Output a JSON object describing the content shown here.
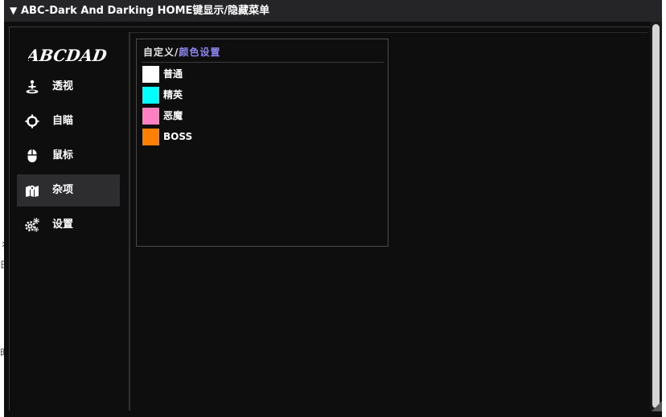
{
  "window": {
    "collapse_arrow": "▼",
    "title": "ABC-Dark And Darking HOME键显示/隐藏菜单"
  },
  "logo": {
    "text": "ABCDAD"
  },
  "sidebar": {
    "items": [
      {
        "label": "透视",
        "icon": "person-icon",
        "active": false
      },
      {
        "label": "自瞄",
        "icon": "crosshair-icon",
        "active": false
      },
      {
        "label": "鼠标",
        "icon": "mouse-icon",
        "active": false
      },
      {
        "label": "杂项",
        "icon": "map-icon",
        "active": true
      },
      {
        "label": "设置",
        "icon": "gears-icon",
        "active": false
      }
    ]
  },
  "panel": {
    "header_part1": "自定义",
    "header_sep": "/",
    "header_part2": "颜色设置",
    "header_part2_color": "#8c86f0",
    "colors": [
      {
        "label": "普通",
        "color": "#ffffff"
      },
      {
        "label": "精英",
        "color": "#00ffff"
      },
      {
        "label": "恶魔",
        "color": "#ff80c0"
      },
      {
        "label": "BOSS",
        "color": "#ff8000"
      }
    ]
  },
  "theme": {
    "window_bg": "#0e0e0e",
    "titlebar_bg": "#252528",
    "active_item_bg": "#2d2d2f"
  },
  "background_fragments": [
    "彳",
    "白",
    "时"
  ]
}
